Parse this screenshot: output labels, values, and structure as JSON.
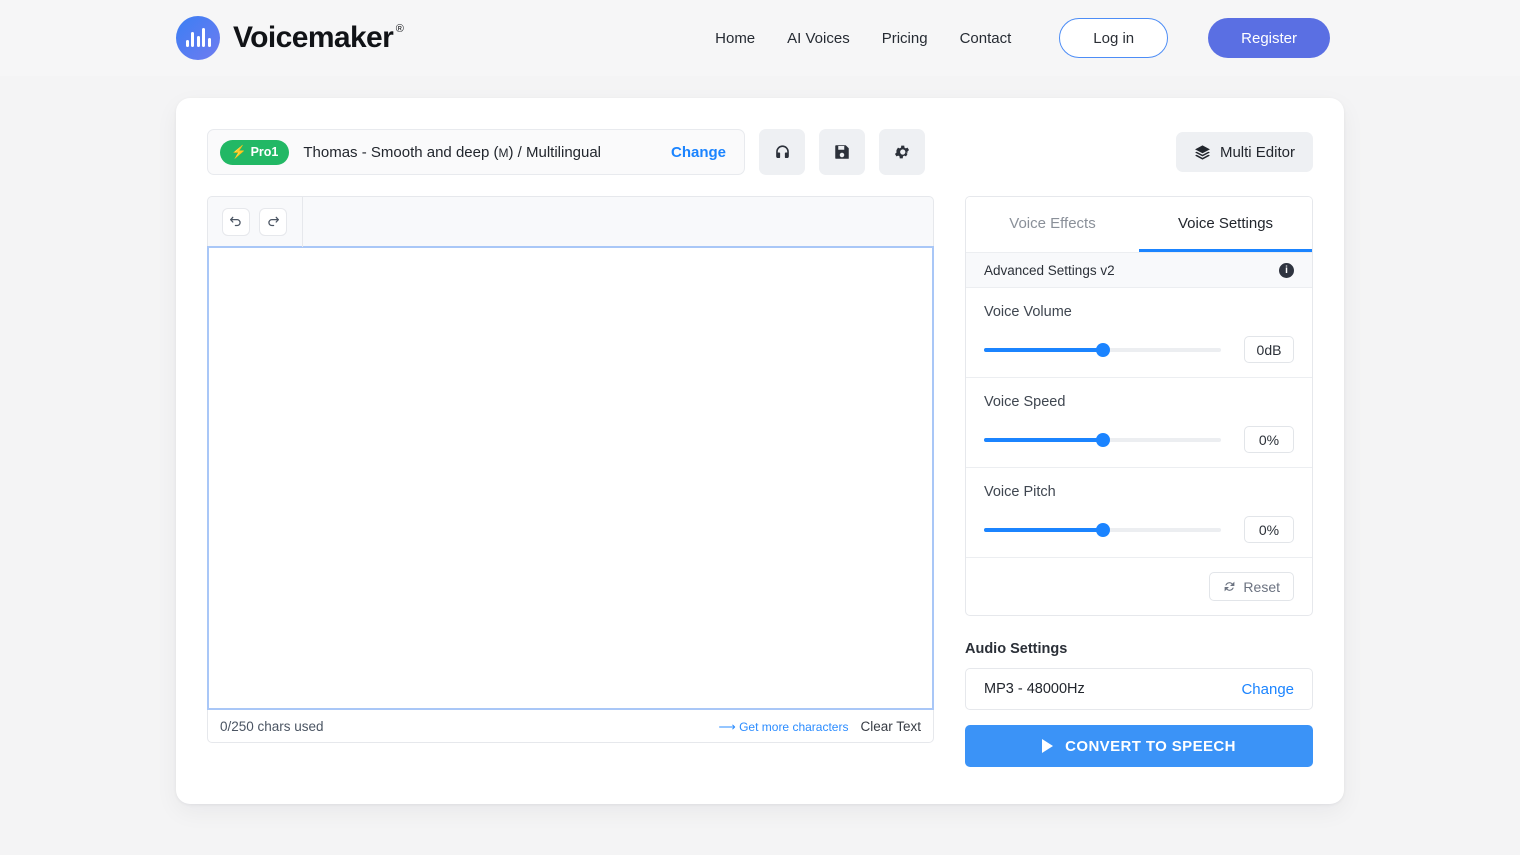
{
  "header": {
    "brand_name": "Voicemaker",
    "brand_trademark": "®",
    "nav": [
      {
        "label": "Home"
      },
      {
        "label": "AI Voices"
      },
      {
        "label": "Pricing"
      },
      {
        "label": "Contact"
      }
    ],
    "login_label": "Log in",
    "register_label": "Register"
  },
  "toolbar": {
    "badge_label": "Pro1",
    "voice_name_prefix": "Thomas - Smooth and deep (",
    "voice_gender": "M",
    "voice_name_suffix": ") / Multilingual",
    "change_label": "Change",
    "listen_icon": "headphones-icon",
    "save_icon": "floppy-disk-icon",
    "settings_icon": "gear-icon",
    "multi_editor_label": "Multi Editor",
    "multi_editor_icon": "layers-icon"
  },
  "editor": {
    "undo_icon": "undo-icon",
    "redo_icon": "redo-icon",
    "text_value": "",
    "placeholder": "",
    "chars_used": "0/250 chars used",
    "get_more_label": "Get more characters",
    "get_more_arrow": "⟶",
    "clear_text_label": "Clear Text"
  },
  "panel": {
    "tabs": [
      {
        "label": "Voice Effects",
        "active": false
      },
      {
        "label": "Voice Settings",
        "active": true
      }
    ],
    "advanced_settings_label": "Advanced Settings v2",
    "info_icon": "info-icon",
    "sliders": [
      {
        "label": "Voice Volume",
        "value": "0dB",
        "percent": 50
      },
      {
        "label": "Voice Speed",
        "value": "0%",
        "percent": 50
      },
      {
        "label": "Voice Pitch",
        "value": "0%",
        "percent": 50
      }
    ],
    "reset_label": "Reset",
    "reset_icon": "refresh-icon",
    "audio_settings_label": "Audio Settings",
    "audio_format": "MP3 - 48000Hz",
    "audio_change_label": "Change",
    "convert_label": "CONVERT TO SPEECH",
    "convert_icon": "play-icon"
  },
  "colors": {
    "accent_blue": "#1b84ff",
    "button_blue": "#3b93f7",
    "register_indigo": "#5a6fe3",
    "pro_green": "#22b865",
    "page_bg": "#f4f4f5"
  }
}
